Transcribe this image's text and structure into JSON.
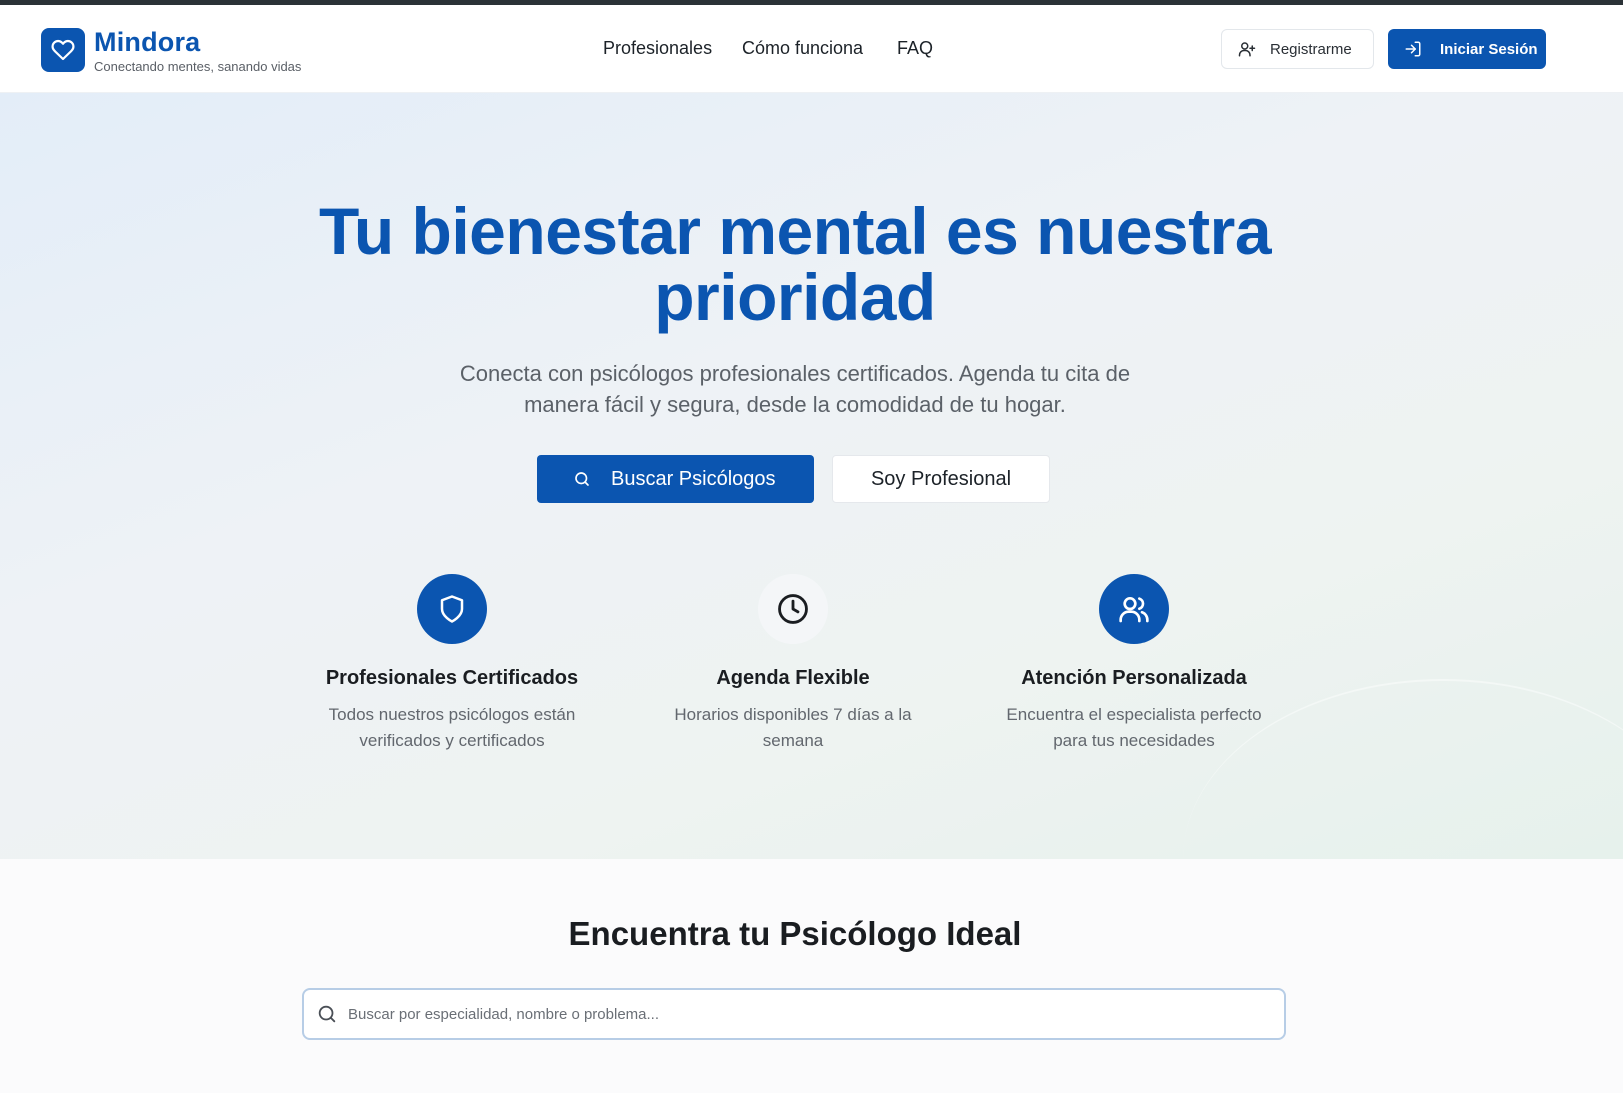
{
  "brand": {
    "name": "Mindora",
    "tagline": "Conectando mentes, sanando vidas",
    "color": "#0b55b0"
  },
  "nav": {
    "items": [
      "Profesionales",
      "Cómo funciona",
      "FAQ"
    ]
  },
  "header": {
    "register_label": "Registrarme",
    "login_label": "Iniciar Sesión"
  },
  "hero": {
    "title_line1": "Tu bienestar mental es nuestra",
    "title_line2": "prioridad",
    "subtitle_line1": "Conecta con psicólogos profesionales certificados. Agenda tu cita de",
    "subtitle_line2": "manera fácil y segura, desde la comodidad de tu hogar.",
    "search_button": "Buscar Psicólogos",
    "pro_button": "Soy Profesional"
  },
  "features": [
    {
      "icon": "shield-icon",
      "title": "Profesionales Certificados",
      "description": "Todos nuestros psicólogos están verificados y certificados"
    },
    {
      "icon": "clock-icon",
      "title": "Agenda Flexible",
      "description": "Horarios disponibles 7 días a la semana"
    },
    {
      "icon": "users-icon",
      "title": "Atención Personalizada",
      "description": "Encuentra el especialista perfecto para tus necesidades"
    }
  ],
  "search_section": {
    "title": "Encuentra tu Psicólogo Ideal",
    "placeholder": "Buscar por especialidad, nombre o problema..."
  }
}
